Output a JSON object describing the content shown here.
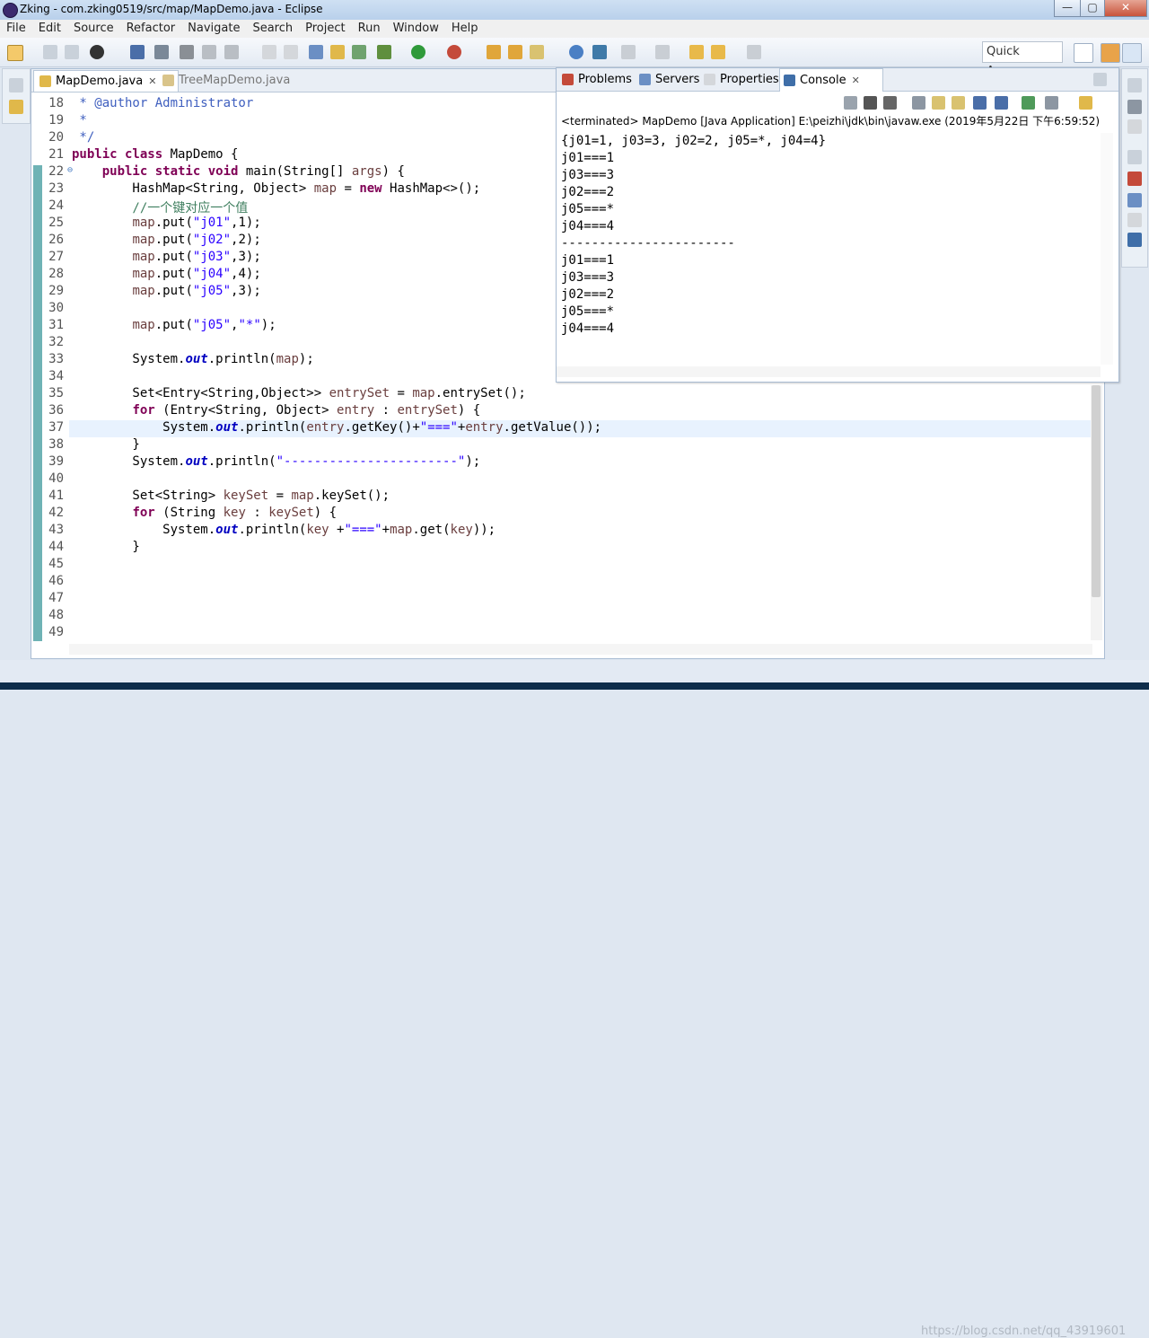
{
  "window": {
    "title": "Zking - com.zking0519/src/map/MapDemo.java - Eclipse",
    "min_glyph": "—",
    "max_glyph": "▢",
    "close_glyph": "✕"
  },
  "menu": [
    "File",
    "Edit",
    "Source",
    "Refactor",
    "Navigate",
    "Search",
    "Project",
    "Run",
    "Window",
    "Help"
  ],
  "quick_access": "Quick Access",
  "editor": {
    "tabs": [
      {
        "label": "MapDemo.java",
        "active": true
      },
      {
        "label": "TreeMapDemo.java",
        "active": false
      }
    ],
    "close_glyph": "✕",
    "line_numbers": [
      "18",
      "19",
      "20",
      "21",
      "22",
      "23",
      "24",
      "25",
      "26",
      "27",
      "28",
      "29",
      "30",
      "31",
      "32",
      "33",
      "34",
      "35",
      "36",
      "37",
      "38",
      "39",
      "40",
      "41",
      "42",
      "43",
      "44",
      "45",
      "46",
      "47",
      "48",
      "49"
    ],
    "line_marker": "⊖",
    "code": [
      [
        [
          "jd",
          " * @author Administrator"
        ]
      ],
      [
        [
          "jd",
          " *"
        ]
      ],
      [
        [
          "jd",
          " */"
        ]
      ],
      [
        [
          "kw",
          "public class"
        ],
        [
          "",
          "MapDemo {"
        ]
      ],
      [
        [
          "",
          "    "
        ],
        [
          "kw",
          "public static void"
        ],
        [
          "",
          " main(String[] "
        ],
        [
          "var",
          "args"
        ],
        [
          "",
          ") {"
        ]
      ],
      [
        [
          "",
          "        HashMap<String, Object> "
        ],
        [
          "var",
          "map"
        ],
        [
          "",
          " = "
        ],
        [
          "kw",
          "new"
        ],
        [
          "",
          " HashMap<>();"
        ]
      ],
      [
        [
          "cm",
          "        //一个键对应一个值"
        ]
      ],
      [
        [
          "",
          "        "
        ],
        [
          "var",
          "map"
        ],
        [
          "",
          ".put("
        ],
        [
          "str",
          "\"j01\""
        ],
        [
          "",
          ",1);"
        ]
      ],
      [
        [
          "",
          "        "
        ],
        [
          "var",
          "map"
        ],
        [
          "",
          ".put("
        ],
        [
          "str",
          "\"j02\""
        ],
        [
          "",
          ",2);"
        ]
      ],
      [
        [
          "",
          "        "
        ],
        [
          "var",
          "map"
        ],
        [
          "",
          ".put("
        ],
        [
          "str",
          "\"j03\""
        ],
        [
          "",
          ",3);"
        ]
      ],
      [
        [
          "",
          "        "
        ],
        [
          "var",
          "map"
        ],
        [
          "",
          ".put("
        ],
        [
          "str",
          "\"j04\""
        ],
        [
          "",
          ",4);"
        ]
      ],
      [
        [
          "",
          "        "
        ],
        [
          "var",
          "map"
        ],
        [
          "",
          ".put("
        ],
        [
          "str",
          "\"j05\""
        ],
        [
          "",
          ",3);"
        ]
      ],
      [],
      [
        [
          "",
          "        "
        ],
        [
          "var",
          "map"
        ],
        [
          "",
          ".put("
        ],
        [
          "str",
          "\"j05\""
        ],
        [
          "",
          ","
        ],
        [
          "str",
          "\"*\""
        ],
        [
          "",
          ");"
        ]
      ],
      [],
      [
        [
          "",
          "        System."
        ],
        [
          "fld",
          "out"
        ],
        [
          "",
          ".println("
        ],
        [
          "var",
          "map"
        ],
        [
          "",
          ");"
        ]
      ],
      [],
      [
        [
          "",
          "        Set<Entry<String,Object>> "
        ],
        [
          "var",
          "entrySet"
        ],
        [
          "",
          " = "
        ],
        [
          "var",
          "map"
        ],
        [
          "",
          ".entrySet();"
        ]
      ],
      [
        [
          "",
          "        "
        ],
        [
          "kw",
          "for"
        ],
        [
          "",
          " (Entry<String, Object> "
        ],
        [
          "var",
          "entry"
        ],
        [
          "",
          " : "
        ],
        [
          "var",
          "entrySet"
        ],
        [
          "",
          ") {"
        ]
      ],
      [
        [
          "",
          "            System."
        ],
        [
          "fld",
          "out"
        ],
        [
          "",
          ".println("
        ],
        [
          "var",
          "entry"
        ],
        [
          "",
          ".getKey()+"
        ],
        [
          "str",
          "\"===\""
        ],
        [
          "",
          "+"
        ],
        [
          "var",
          "entry"
        ],
        [
          "",
          ".getValue());"
        ]
      ],
      [
        [
          "",
          "        }"
        ]
      ],
      [
        [
          "",
          "        System."
        ],
        [
          "fld",
          "out"
        ],
        [
          "",
          ".println("
        ],
        [
          "str",
          "\"-----------------------\""
        ],
        [
          "",
          ");"
        ]
      ],
      [],
      [
        [
          "",
          "        Set<String> "
        ],
        [
          "var",
          "keySet"
        ],
        [
          "",
          " = "
        ],
        [
          "var",
          "map"
        ],
        [
          "",
          ".keySet();"
        ]
      ],
      [
        [
          "",
          "        "
        ],
        [
          "kw",
          "for"
        ],
        [
          "",
          " (String "
        ],
        [
          "var",
          "key"
        ],
        [
          "",
          " : "
        ],
        [
          "var",
          "keySet"
        ],
        [
          "",
          ") {"
        ]
      ],
      [
        [
          "",
          "            System."
        ],
        [
          "fld",
          "out"
        ],
        [
          "",
          ".println("
        ],
        [
          "var",
          "key"
        ],
        [
          "",
          " +"
        ],
        [
          "str",
          "\"===\""
        ],
        [
          "",
          "+"
        ],
        [
          "var",
          "map"
        ],
        [
          "",
          ".get("
        ],
        [
          "var",
          "key"
        ],
        [
          "",
          "));"
        ]
      ],
      [
        [
          "",
          "        }"
        ]
      ],
      [],
      [],
      [],
      [],
      []
    ]
  },
  "console": {
    "tabs": [
      {
        "label": "Problems",
        "active": false
      },
      {
        "label": "Servers",
        "active": false
      },
      {
        "label": "Properties",
        "active": false
      },
      {
        "label": "Console",
        "active": true
      }
    ],
    "close_glyph": "✕",
    "status": "<terminated> MapDemo [Java Application] E:\\peizhi\\jdk\\bin\\javaw.exe (2019年5月22日 下午6:59:52)",
    "output": [
      "{j01=1, j03=3, j02=2, j05=*, j04=4}",
      "j01===1",
      "j03===3",
      "j02===2",
      "j05===*",
      "j04===4",
      "-----------------------",
      "j01===1",
      "j03===3",
      "j02===2",
      "j05===*",
      "j04===4"
    ]
  },
  "watermark": "https://blog.csdn.net/qq_43919601"
}
